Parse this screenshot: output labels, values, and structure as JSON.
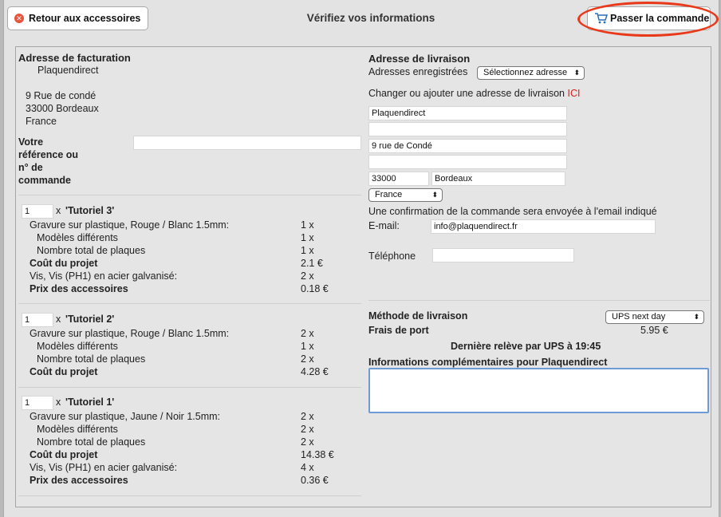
{
  "header": {
    "back_label": "Retour aux accessoires",
    "title": "Vérifiez vos informations",
    "order_label": "Passer la commande"
  },
  "billing": {
    "heading": "Adresse de facturation",
    "company": "Plaquendirect",
    "street": "9 Rue de condé",
    "city": "33000 Bordeaux",
    "country": "France",
    "reference_label_1": "Votre",
    "reference_label_2": "référence ou",
    "reference_label_3": "n° de",
    "reference_label_4": "commande",
    "reference_value": ""
  },
  "projects": [
    {
      "qty": "1",
      "x": "x",
      "name": "'Tutoriel 3'",
      "engraving": "Gravure sur plastique, Rouge / Blanc 1.5mm:",
      "engraving_qty": "1 x",
      "models_label": "Modèles différents",
      "models_qty": "1 x",
      "plates_label": "Nombre total de plaques",
      "plates_qty": "1 x",
      "cost_label": "Coût du projet",
      "cost": "2.1 €",
      "screws_label": "Vis, Vis (PH1) en acier galvanisé:",
      "screws_qty": "2 x",
      "acc_label": "Prix des accessoires",
      "acc_price": "0.18 €"
    },
    {
      "qty": "1",
      "x": "x",
      "name": "'Tutoriel 2'",
      "engraving": "Gravure sur plastique, Rouge / Blanc 1.5mm:",
      "engraving_qty": "2 x",
      "models_label": "Modèles différents",
      "models_qty": "1 x",
      "plates_label": "Nombre total de plaques",
      "plates_qty": "2 x",
      "cost_label": "Coût du projet",
      "cost": "4.28 €"
    },
    {
      "qty": "1",
      "x": "x",
      "name": "'Tutoriel 1'",
      "engraving": "Gravure sur plastique, Jaune / Noir 1.5mm:",
      "engraving_qty": "2 x",
      "models_label": "Modèles différents",
      "models_qty": "2 x",
      "plates_label": "Nombre total de plaques",
      "plates_qty": "2 x",
      "cost_label": "Coût du projet",
      "cost": "14.38 €",
      "screws_label": "Vis, Vis (PH1) en acier galvanisé:",
      "screws_qty": "4 x",
      "acc_label": "Prix des accessoires",
      "acc_price": "0.36 €"
    }
  ],
  "shipping": {
    "heading": "Adresse de livraison",
    "saved_label": "Adresses enregistrées",
    "saved_select": "Sélectionnez adresse",
    "change_text": "Changer ou ajouter une adresse de livraison",
    "change_link": "ICI",
    "line1": "Plaquendirect",
    "line2": "",
    "line3": "9 rue de Condé",
    "line4": "",
    "zip": "33000",
    "city": "Bordeaux",
    "country": "France",
    "confirm_text": "Une confirmation de la commande sera envoyée à l'email indiqué",
    "email_label": "E-mail:",
    "email": "info@plaquendirect.fr",
    "phone_label": "Téléphone",
    "phone": "",
    "method_label": "Méthode de livraison",
    "method_value": "UPS next day",
    "fee_label": "Frais de port",
    "fee_value": "5.95 €",
    "pickup": "Dernière relève par UPS à 19:45",
    "info_label": "Informations complémentaires pour Plaquendirect"
  }
}
